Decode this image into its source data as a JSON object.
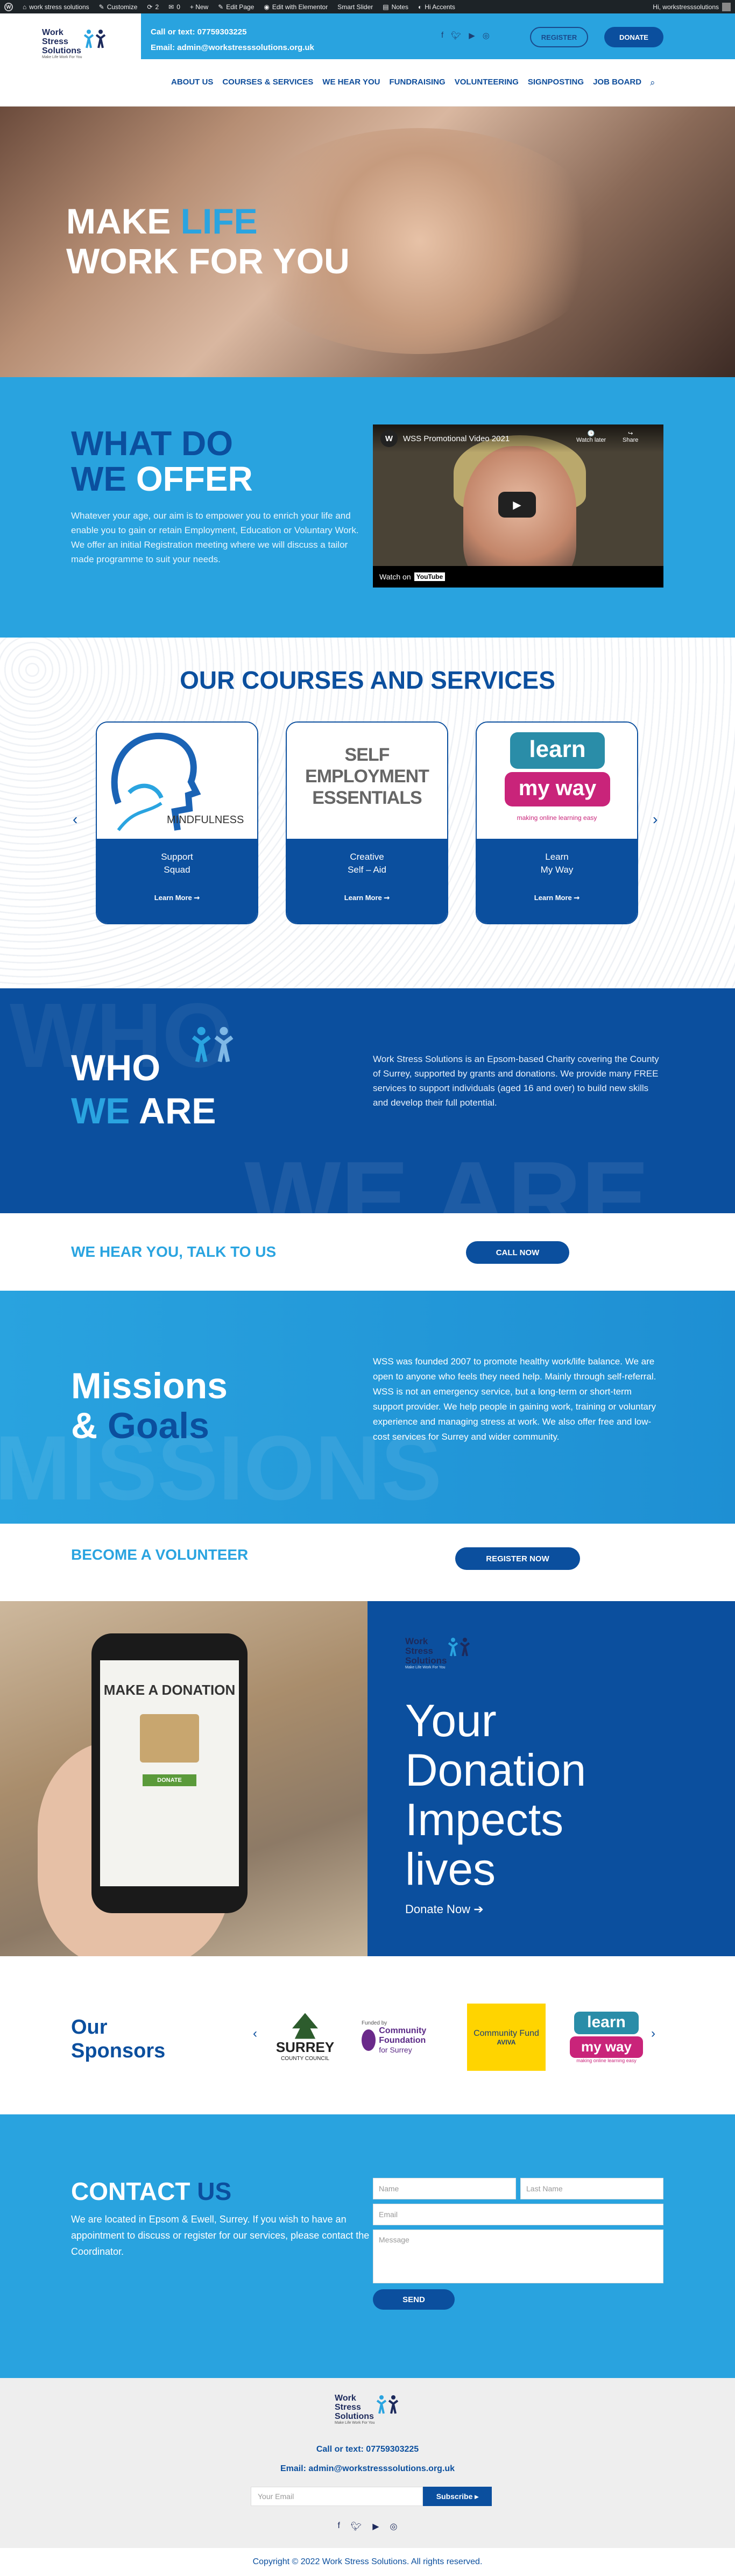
{
  "admin_bar": {
    "site": "work stress solutions",
    "customize": "Customize",
    "comments": "2",
    "updates": "0",
    "new": "+ New",
    "edit": "Edit Page",
    "elementor": "Edit with Elementor",
    "slider": "Smart Slider",
    "notes": "Notes",
    "accents": "Hi Accents",
    "greeting": "Hi, workstresssolutions"
  },
  "header": {
    "call": "Call or text: 07759303225",
    "email": "Email: admin@workstresssolutions.org.uk",
    "register": "REGISTER",
    "donate": "DONATE",
    "logo_line1": "Work",
    "logo_line2": "Stress",
    "logo_line3": "Solutions",
    "logo_tag": "Make Life Work For You"
  },
  "nav": [
    "ABOUT US",
    "COURSES & SERVICES",
    "WE HEAR YOU",
    "FUNDRAISING",
    "VOLUNTEERING",
    "SIGNPOSTING",
    "JOB BOARD"
  ],
  "hero": {
    "make": "MAKE",
    "life": "LIFE",
    "line2": "WORK FOR YOU"
  },
  "offer": {
    "title_what": "WHAT DO",
    "title_we": "WE",
    "title_offer": "OFFER",
    "text": "Whatever your age, our aim is to empower you to enrich your life and enable you to gain or retain Employment, Education or Voluntary Work. We offer an initial Registration meeting where we will discuss a tailor made programme to suit your needs.",
    "video_title": "WSS Promotional Video 2021",
    "watch_later": "Watch later",
    "share": "Share",
    "watch_on": "Watch on",
    "youtube": "YouTube"
  },
  "courses": {
    "title": "OUR COURSES AND SERVICES",
    "cards": [
      {
        "t1": "Support",
        "t2": "Squad",
        "img": "MINDFULNESS",
        "more": "Learn More"
      },
      {
        "t1": "Creative",
        "t2": "Self – Aid",
        "img": "SELF EMPLOYMENT ESSENTIALS",
        "more": "Learn More"
      },
      {
        "t1": "Learn",
        "t2": "My Way",
        "img": "learn my way",
        "img_sub": "making online learning easy",
        "more": "Learn More"
      }
    ]
  },
  "who": {
    "ghost1": "WHO",
    "ghost2": "WE ARE",
    "title_who": "WHO",
    "title_we": "WE",
    "title_are": "ARE",
    "text": "Work Stress Solutions is an Epsom-based Charity covering the County of Surrey, supported by grants and donations. We provide many FREE services to support individuals (aged 16 and over) to build new skills and develop their full potential."
  },
  "hear": {
    "title": "WE HEAR YOU, TALK TO US",
    "button": "CALL NOW"
  },
  "missions": {
    "ghost": "MISSIONS",
    "title1": "Missions",
    "amp": "&",
    "title2": "Goals",
    "text": "WSS was founded 2007 to promote healthy work/life balance. We are open to anyone who feels they need help. Mainly through self-referral. WSS is not an emergency service, but a long-term or short-term support provider. We help people in gaining work, training or voluntary experience and managing stress at work. We also offer free and low-cost services for Surrey and wider community."
  },
  "volunteer": {
    "title": "BECOME A VOLUNTEER",
    "button": "REGISTER NOW"
  },
  "donation": {
    "phone_title": "MAKE A DONATION",
    "phone_button": "DONATE",
    "headline": "Your Donation Impects lives",
    "cta": "Donate Now"
  },
  "sponsors": {
    "title1": "Our",
    "title2": "Sponsors",
    "items": [
      {
        "name": "SURREY",
        "sub": "COUNTY COUNCIL"
      },
      {
        "name": "Community Foundation",
        "sub": "for Surrey",
        "pre": "Funded by"
      },
      {
        "name": "Community Fund",
        "sub": "AVIVA"
      },
      {
        "name": "learn my way",
        "sub": "making online learning easy"
      }
    ]
  },
  "contact": {
    "title_contact": "CONTACT",
    "title_us": "US",
    "text": "We are located in Epsom & Ewell, Surrey. If you wish to have an appointment to discuss or register for our services, please contact the Coordinator.",
    "name_ph": "Name",
    "last_ph": "Last Name",
    "email_ph": "Email",
    "msg_ph": "Message",
    "send": "SEND"
  },
  "footer": {
    "call": "Call or text: 07759303225",
    "email": "Email: admin@workstresssolutions.org.uk",
    "email_ph": "Your Email",
    "subscribe": "Subscribe ▸",
    "copyright": "Copyright © 2022 Work Stress Solutions. All rights reserved."
  },
  "colors": {
    "primary": "#0b4f9e",
    "accent": "#29a3df",
    "admin": "#1d2327"
  }
}
